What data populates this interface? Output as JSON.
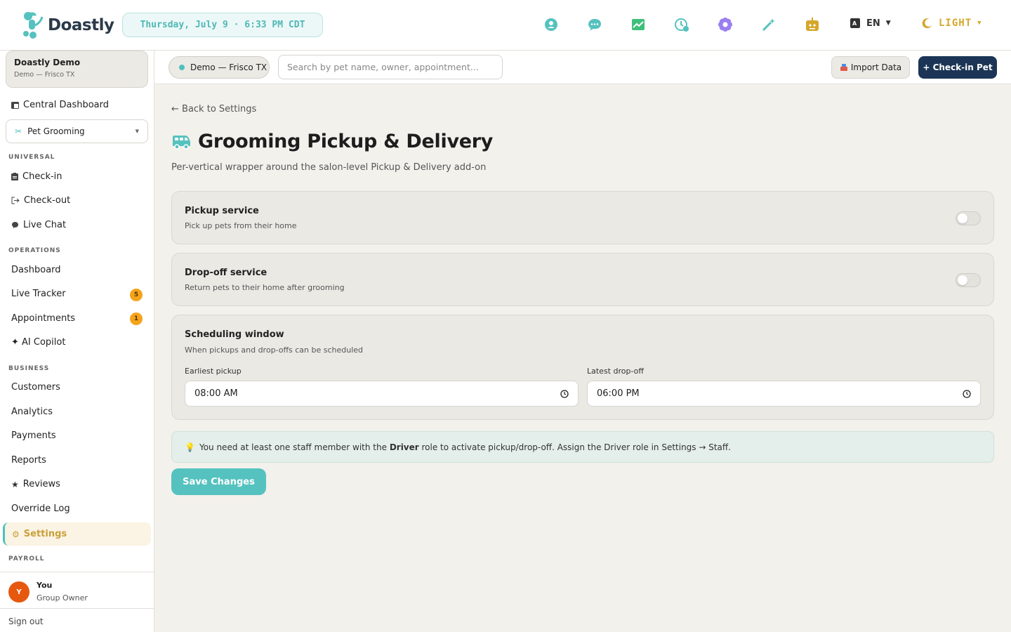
{
  "app": {
    "name": "Doastly",
    "datetime": "Thursday, July 9 · 6:33 PM CDT",
    "language": "EN",
    "theme": "LIGHT",
    "accent": "#55c2bf",
    "brand_dark": "#1c3556"
  },
  "toolbar_icons": [
    "support-icon",
    "chat-icon",
    "chart-icon",
    "clock-icon",
    "flower-icon",
    "magic-wand-icon",
    "robot-icon"
  ],
  "sidebar": {
    "org_name": "Doastly Demo",
    "org_location": "Demo — Frisco TX",
    "central_dashboard": "Central Dashboard",
    "vertical": "Pet Grooming",
    "sections": {
      "universal": "UNIVERSAL",
      "operations": "OPERATIONS",
      "business": "BUSINESS",
      "payroll": "PAYROLL"
    },
    "universal_items": [
      "Check-in",
      "Check-out",
      "Live Chat"
    ],
    "operations_items": [
      "Dashboard",
      "Live Tracker",
      "Appointments",
      "✦ AI Copilot"
    ],
    "badges": {
      "live_tracker": "5",
      "appointments": "1"
    },
    "business_items": [
      "Customers",
      "Analytics",
      "Payments",
      "Reports",
      "Reviews",
      "Override Log"
    ],
    "active_item": "Settings",
    "user": {
      "initial": "Y",
      "name": "You",
      "role": "Group Owner"
    },
    "sign_out": "Sign out"
  },
  "header": {
    "location": "Demo — Frisco TX",
    "search_placeholder": "Search by pet name, owner, appointment...",
    "import_label": "Import Data",
    "checkin_label": "+ Check-in Pet"
  },
  "page": {
    "back_link": "← Back to Settings",
    "title": "Grooming Pickup & Delivery",
    "subtitle": "Per-vertical wrapper around the salon-level Pickup & Delivery add-on",
    "pickup": {
      "title": "Pickup service",
      "desc": "Pick up pets from their home",
      "enabled": false
    },
    "dropoff": {
      "title": "Drop-off service",
      "desc": "Return pets to their home after grooming",
      "enabled": false
    },
    "schedule": {
      "title": "Scheduling window",
      "desc": "When pickups and drop-offs can be scheduled",
      "earliest_label": "Earliest pickup",
      "earliest_value": "08:00 AM",
      "latest_label": "Latest drop-off",
      "latest_value": "06:00 PM"
    },
    "info": {
      "prefix": "You need at least one staff member with the",
      "role": "Driver",
      "suffix": "role to activate pickup/drop-off. Assign the Driver role in Settings → Staff."
    },
    "save_label": "Save Changes"
  }
}
